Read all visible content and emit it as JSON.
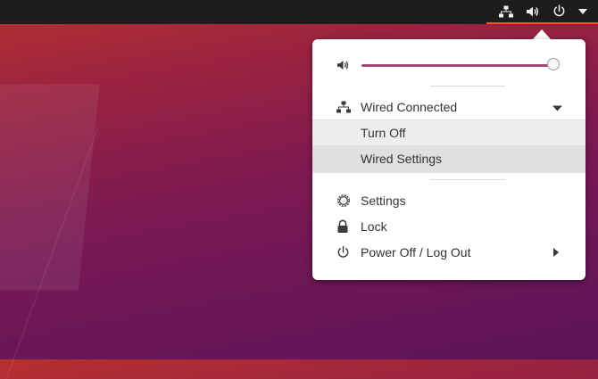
{
  "topbar": {
    "icons": [
      "network-wired-icon",
      "volume-icon",
      "power-icon",
      "dropdown-arrow-icon"
    ],
    "accent_color": "#e95420"
  },
  "menu": {
    "volume": {
      "level": 0.97,
      "icon": "volume-icon"
    },
    "network": {
      "label": "Wired Connected",
      "icon": "network-wired-icon",
      "items": [
        {
          "label": "Turn Off"
        },
        {
          "label": "Wired Settings"
        }
      ]
    },
    "items": [
      {
        "label": "Settings",
        "icon": "gear-icon"
      },
      {
        "label": "Lock",
        "icon": "lock-icon"
      },
      {
        "label": "Power Off / Log Out",
        "icon": "power-icon"
      }
    ]
  }
}
